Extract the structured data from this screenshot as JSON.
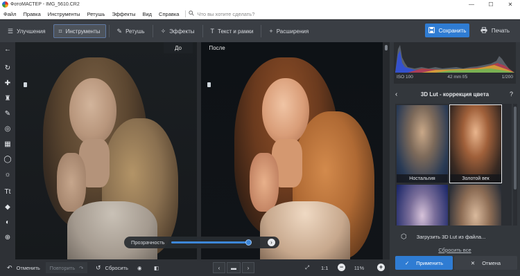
{
  "window": {
    "title": "ФотоМАСТЕР - IMG_5610.CR2",
    "minimize": "—",
    "maximize": "☐",
    "close": "✕"
  },
  "menu": {
    "items": [
      "Файл",
      "Правка",
      "Инструменты",
      "Ретушь",
      "Эффекты",
      "Вид",
      "Справка"
    ],
    "search_placeholder": "Что вы хотите сделать?"
  },
  "toolbar": {
    "tabs": [
      {
        "label": "Улучшения",
        "icon": "sliders-icon"
      },
      {
        "label": "Инструменты",
        "icon": "crop-icon",
        "active": true
      },
      {
        "label": "Ретушь",
        "icon": "brush-icon"
      },
      {
        "label": "Эффекты",
        "icon": "magic-wand-icon"
      },
      {
        "label": "Текст и рамки",
        "icon": "text-icon"
      },
      {
        "label": "Расширения",
        "icon": "plus-icon"
      }
    ],
    "save_label": "Сохранить",
    "print_label": "Печать"
  },
  "canvas": {
    "before_label": "До",
    "after_label": "После",
    "opacity_label": "Прозрачность",
    "opacity_value": 1.0
  },
  "histogram": {
    "iso": "ISO 100",
    "focal": "42 mm f/5",
    "shutter": "1/200"
  },
  "panel": {
    "title": "3D Lut - коррекция цвета",
    "luts": [
      {
        "name": "Ностальгия",
        "selected": false
      },
      {
        "name": "Золотой век",
        "selected": true
      },
      {
        "name": "",
        "selected": false
      },
      {
        "name": "",
        "selected": false
      }
    ],
    "load_label": "Загрузить 3D Lut из файла...",
    "reset_all_label": "Сбросить все",
    "apply_label": "Применить",
    "cancel_label": "Отмена"
  },
  "bottom": {
    "undo_label": "Отменить",
    "redo_label": "Повторить",
    "reset_label": "Сбросить",
    "one_to_one": "1:1",
    "zoom": "11%"
  },
  "colors": {
    "accent": "#2f7cd3",
    "panel_bg": "#33373c",
    "canvas_bg": "#111417"
  }
}
